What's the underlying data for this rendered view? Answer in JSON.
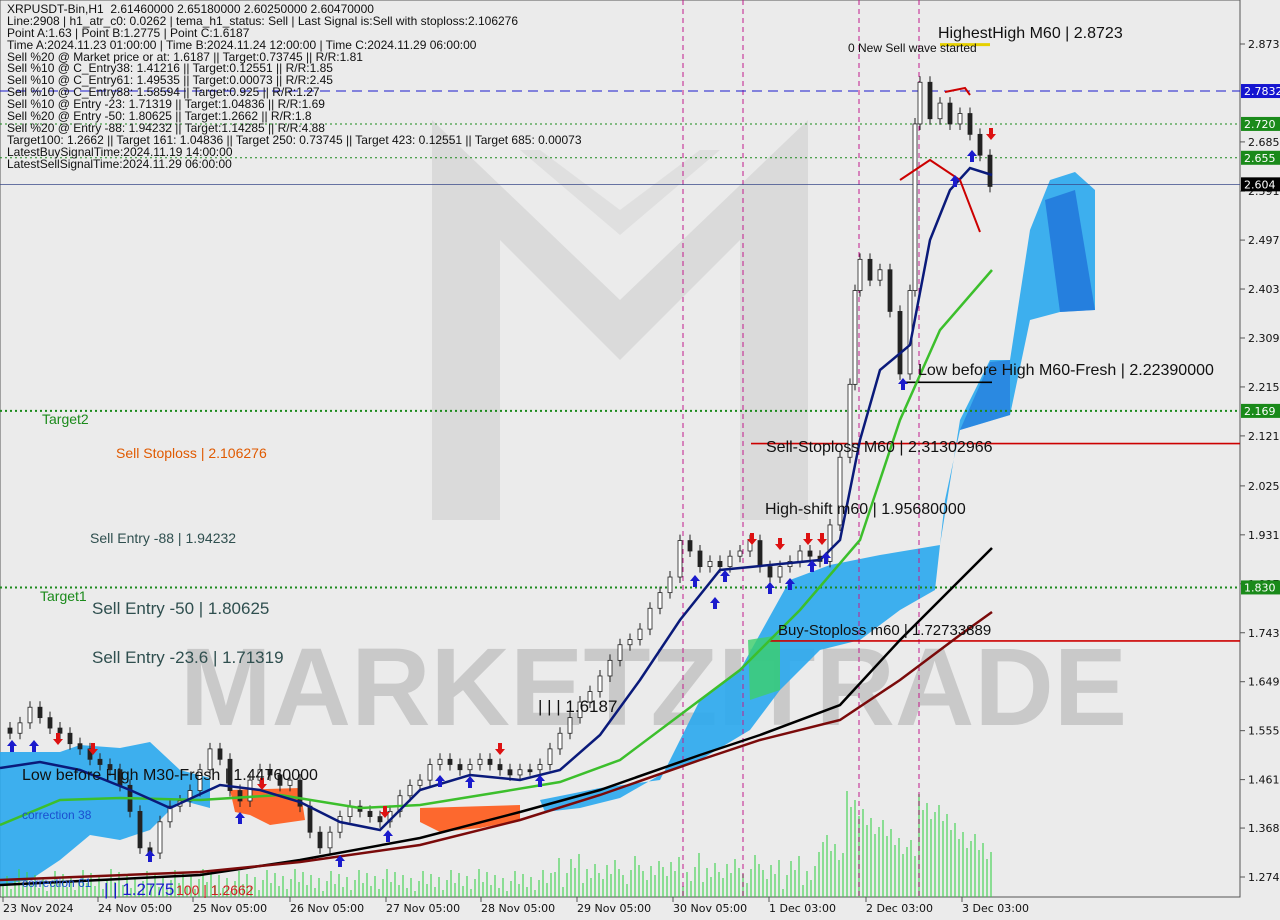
{
  "info_lines": [
    "XRPUSDT-Bin,H1  2.61460000 2.65180000 2.60250000 2.60470000",
    "Line:2908 | h1_atr_c0: 0.0262 | tema_h1_status: Sell | Last Signal is:Sell with stoploss:2.106276",
    "Point A:1.63 | Point B:1.2775 | Point C:1.6187",
    "Time A:2024.11.23 01:00:00 | Time B:2024.11.24 12:00:00 | Time C:2024.11.29 06:00:00",
    "Sell %20 @ Market price or at: 1.6187 || Target:0.73745 || R/R:1.81",
    "Sell %10 @ C_Entry38: 1.41216 || Target:0.12551 || R/R:1.85",
    "Sell %10 @ C_Entry61: 1.49535 || Target:0.00073 || R/R:2.45",
    "Sell %10 @ C_Entry88: 1.58594 || Target:0.925 || R/R:1.27",
    "Sell %10 @ Entry -23: 1.71319 || Target:1.04836 || R/R:1.69",
    "Sell %20 @ Entry -50: 1.80625 || Target:1.2662 || R/R:1.8",
    "Sell %20 @ Entry -88: 1.94232 || Target:1.14285 || R/R:4.88",
    "Target100: 1.2662 || Target 161: 1.04836 || Target 250: 0.73745 || Target 423: 0.12551 || Target 685: 0.00073",
    "LatestBuySignalTime:2024.11.19 14:00:00",
    "LatestSellSignalTime:2024.11.29 06:00:00"
  ],
  "colors": {
    "background": "#ebebeb",
    "target_line": "#1a8a1a",
    "sell_stop_line": "#cc0000",
    "current_line": "#1e3a8a",
    "blue_dash": "#1a1acc",
    "vline": "#c21b8c",
    "price_green": "#1a8a1a",
    "price_blue": "#1515d0",
    "price_black": "#000000",
    "cloud_light": "#2aa9ee",
    "cloud_dark": "#1e6fd8",
    "cloud_orange": "#ff5a1a",
    "tema_navy": "#0a1a7a",
    "sma_green": "#3cbf2c",
    "ma_black": "#000000",
    "ma_maroon": "#7a0a0a"
  },
  "annotations": {
    "highest_high": "HighestHigh    M60 | 2.8723",
    "new_sell_wave": "0 New Sell wave started",
    "low_before_high_m60": "Low before High    M60-Fresh | 2.22390000",
    "sell_stoploss_m60": "Sell-Stoploss M60 | 2.31302966",
    "high_shift_m60": "High-shift m60 | 1.95680000",
    "buy_stoploss_m60": "Buy-Stoploss m60 | 1.72733889",
    "sell_stoploss": "Sell Stoploss | 2.106276",
    "target2": "Target2",
    "target1": "Target1",
    "sell_entry_88": "Sell Entry -88 | 1.94232",
    "sell_entry_50": "Sell Entry -50 | 1.80625",
    "sell_entry_23": "Sell Entry -23.6 | 1.71319",
    "c_point": "| | | 1.6187",
    "low_before_high_m30": "Low before High    M30-Fresh | 1.44760000",
    "correction_38": "correction 38",
    "correction_61": "correction 61",
    "b_point": "| | 1.2775",
    "target100": "100 | 1.2662",
    "watermark": "MARKETZITRADE"
  },
  "price_labels": [
    {
      "text": "2.7832",
      "kind": "blue_line"
    },
    {
      "text": "2.720",
      "kind": "green_box"
    },
    {
      "text": "2.655",
      "kind": "green_box"
    },
    {
      "text": "2.604",
      "kind": "black_box"
    },
    {
      "text": "2.169",
      "kind": "green_box"
    },
    {
      "text": "1.830",
      "kind": "green_box"
    }
  ],
  "chart_data": {
    "type": "candlestick",
    "symbol": "XRPUSDT-Bin",
    "timeframe": "H1",
    "y_range": [
      1.22,
      2.93
    ],
    "y_ticks": [
      2.8735,
      2.6855,
      2.591,
      2.497,
      2.403,
      2.309,
      2.215,
      2.121,
      2.025,
      1.931,
      1.837,
      1.743,
      1.649,
      1.555,
      1.461,
      1.368,
      1.274
    ],
    "y_tick_labels": [
      "2.8735",
      "2.6855",
      "2.591",
      "2.497",
      "2.403",
      "2.309",
      "2.215",
      "2.121",
      "2.025",
      "1.931",
      "1.837",
      "1.743",
      "1.649",
      "1.555",
      "1.461",
      "1.368",
      "1.274"
    ],
    "x_labels": [
      "23 Nov 2024",
      "24 Nov 05:00",
      "25 Nov 05:00",
      "26 Nov 05:00",
      "27 Nov 05:00",
      "28 Nov 05:00",
      "29 Nov 05:00",
      "30 Nov 05:00",
      "1 Dec 03:00",
      "2 Dec 03:00",
      "3 Dec 03:00"
    ],
    "levels": {
      "highest_high": 2.8723,
      "blue_dashed": 2.7832,
      "green_upper": 2.72,
      "green_mid": 2.655,
      "current": 2.604,
      "target2": 2.169,
      "sell_stoploss": 2.106276,
      "target1": 1.83,
      "buy_stoploss": 1.72733889
    },
    "candle_path": [
      [
        0,
        1.56
      ],
      [
        10,
        1.55
      ],
      [
        20,
        1.57
      ],
      [
        30,
        1.6
      ],
      [
        40,
        1.58
      ],
      [
        50,
        1.56
      ],
      [
        60,
        1.55
      ],
      [
        70,
        1.53
      ],
      [
        80,
        1.52
      ],
      [
        90,
        1.5
      ],
      [
        100,
        1.49
      ],
      [
        110,
        1.48
      ],
      [
        120,
        1.45
      ],
      [
        130,
        1.4
      ],
      [
        140,
        1.33
      ],
      [
        150,
        1.32
      ],
      [
        160,
        1.38
      ],
      [
        170,
        1.41
      ],
      [
        180,
        1.42
      ],
      [
        190,
        1.44
      ],
      [
        200,
        1.48
      ],
      [
        210,
        1.52
      ],
      [
        220,
        1.5
      ],
      [
        230,
        1.44
      ],
      [
        240,
        1.42
      ],
      [
        250,
        1.46
      ],
      [
        260,
        1.48
      ],
      [
        270,
        1.47
      ],
      [
        280,
        1.45
      ],
      [
        290,
        1.46
      ],
      [
        300,
        1.41
      ],
      [
        310,
        1.36
      ],
      [
        320,
        1.33
      ],
      [
        330,
        1.36
      ],
      [
        340,
        1.39
      ],
      [
        350,
        1.41
      ],
      [
        360,
        1.4
      ],
      [
        370,
        1.39
      ],
      [
        380,
        1.38
      ],
      [
        390,
        1.4
      ],
      [
        400,
        1.43
      ],
      [
        410,
        1.45
      ],
      [
        420,
        1.46
      ],
      [
        430,
        1.49
      ],
      [
        440,
        1.5
      ],
      [
        450,
        1.49
      ],
      [
        460,
        1.48
      ],
      [
        470,
        1.49
      ],
      [
        480,
        1.5
      ],
      [
        490,
        1.49
      ],
      [
        500,
        1.48
      ],
      [
        510,
        1.47
      ],
      [
        520,
        1.48
      ],
      [
        530,
        1.48
      ],
      [
        540,
        1.49
      ],
      [
        550,
        1.52
      ],
      [
        560,
        1.55
      ],
      [
        570,
        1.58
      ],
      [
        580,
        1.61
      ],
      [
        590,
        1.63
      ],
      [
        600,
        1.66
      ],
      [
        610,
        1.69
      ],
      [
        620,
        1.72
      ],
      [
        630,
        1.73
      ],
      [
        640,
        1.75
      ],
      [
        650,
        1.79
      ],
      [
        660,
        1.82
      ],
      [
        670,
        1.85
      ],
      [
        680,
        1.92
      ],
      [
        690,
        1.9
      ],
      [
        700,
        1.87
      ],
      [
        710,
        1.88
      ],
      [
        720,
        1.87
      ],
      [
        730,
        1.89
      ],
      [
        740,
        1.9
      ],
      [
        750,
        1.92
      ],
      [
        760,
        1.87
      ],
      [
        770,
        1.85
      ],
      [
        780,
        1.87
      ],
      [
        790,
        1.88
      ],
      [
        800,
        1.9
      ],
      [
        810,
        1.89
      ],
      [
        820,
        1.88
      ],
      [
        830,
        1.95
      ],
      [
        840,
        2.08
      ],
      [
        850,
        2.22
      ],
      [
        855,
        2.4
      ],
      [
        860,
        2.46
      ],
      [
        870,
        2.42
      ],
      [
        880,
        2.44
      ],
      [
        890,
        2.36
      ],
      [
        900,
        2.24
      ],
      [
        910,
        2.4
      ],
      [
        915,
        2.72
      ],
      [
        920,
        2.8
      ],
      [
        930,
        2.73
      ],
      [
        940,
        2.76
      ],
      [
        950,
        2.72
      ],
      [
        960,
        2.74
      ],
      [
        970,
        2.7
      ],
      [
        980,
        2.66
      ],
      [
        990,
        2.6
      ]
    ]
  }
}
